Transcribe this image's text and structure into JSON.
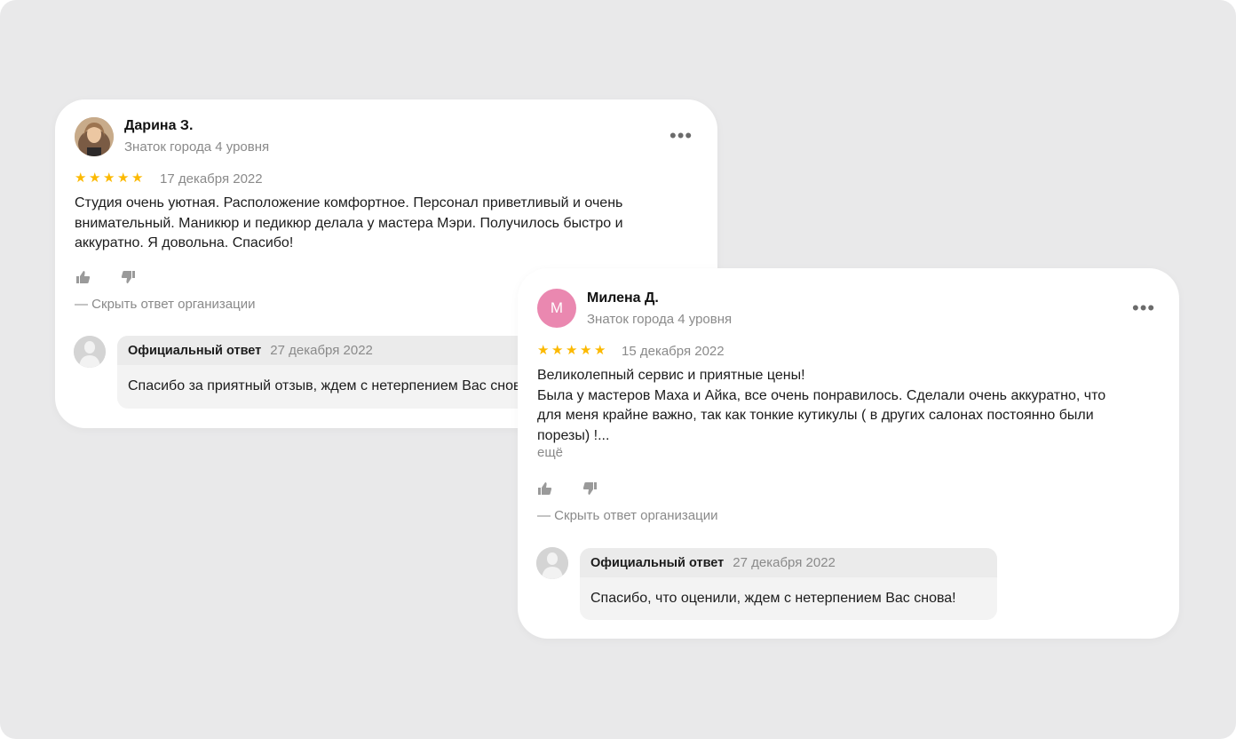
{
  "reviews": [
    {
      "author": "Дарина З.",
      "level": "Знаток города 4 уровня",
      "rating": 5,
      "date": "17 декабря 2022",
      "text_lines": [
        "Студия очень уютная. Расположение комфортное. Персонал приветливый и очень",
        "внимательный. Маникюр и педикюр делала у мастера Мэри. Получилось быстро и",
        "аккуратно. Я довольна. Спасибо!"
      ],
      "hide_reply": "— Скрыть ответ организации",
      "reply": {
        "label": "Официальный ответ",
        "date": "27 декабря 2022",
        "text": "Спасибо за приятный отзыв, ждем с нетерпением Вас снова!"
      }
    },
    {
      "author": "Милена Д.",
      "avatar_letter": "М",
      "level": "Знаток города 4 уровня",
      "rating": 5,
      "date": "15 декабря 2022",
      "text_lines": [
        "Великолепный сервис и приятные цены!",
        "Была у мастеров Маха и Айка, все очень понравилось. Сделали очень аккуратно, что",
        "для меня крайне важно, так как тонкие кутикулы ( в других салонах постоянно были",
        "порезы) !..."
      ],
      "more": "ещё",
      "hide_reply": "— Скрыть ответ организации",
      "reply": {
        "label": "Официальный ответ",
        "date": "27 декабря 2022",
        "text": "Спасибо, что оценили, ждем с нетерпением Вас снова!"
      }
    }
  ],
  "menu_icon": "more-dots-icon",
  "colors": {
    "background": "#e9e9ea",
    "star": "#fcb900",
    "avatar_pink": "#ea88b0",
    "muted_text": "#8a8a8a"
  }
}
